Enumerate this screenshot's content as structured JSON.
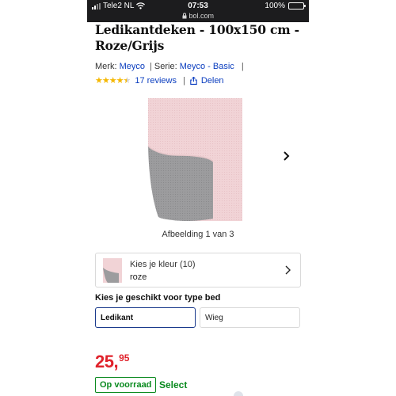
{
  "status_bar": {
    "carrier": "Tele2 NL",
    "time": "07:53",
    "url": "bol.com",
    "battery_percent": "100%",
    "battery_level": 1.0
  },
  "product": {
    "title": "Ledikantdeken - 100x150 cm - Roze/Grijs",
    "brand_label": "Merk:",
    "brand": "Meyco",
    "series_label": "Serie:",
    "series": "Meyco - Basic",
    "rating": 4.5,
    "reviews_label": "17 reviews",
    "share_label": "Delen",
    "image_counter": "Afbeelding 1 van 3"
  },
  "color_select": {
    "label": "Kies je kleur (10)",
    "value": "roze"
  },
  "bed_type": {
    "heading": "Kies je geschikt voor type bed",
    "options": [
      {
        "label": "Ledikant",
        "selected": true
      },
      {
        "label": "Wieg",
        "selected": false
      }
    ]
  },
  "price": {
    "euros": "25,",
    "cents": "95"
  },
  "stock": {
    "badge": "Op voorraad",
    "program": "Select"
  },
  "colors": {
    "link": "#0a3dbf",
    "price": "#e0222b",
    "stock": "#0a8a1f",
    "star": "#f5b700",
    "blanket_pink": "#f1d3d6",
    "blanket_grey": "#9c9c9e"
  },
  "icons": [
    "wifi-icon",
    "share-icon",
    "chevron-right-icon",
    "star-icon"
  ]
}
